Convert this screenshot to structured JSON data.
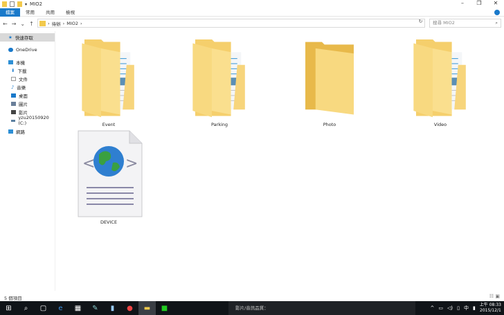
{
  "window": {
    "title": "MIO2",
    "minimize": "–",
    "restore": "❐",
    "close": "✕"
  },
  "ribbon": {
    "tabs": [
      "檔案",
      "常用",
      "共用",
      "檢視"
    ]
  },
  "nav": {
    "back": "←",
    "forward": "→",
    "recent": "⌄",
    "up": "↑",
    "path": [
      "待辦",
      "MIO2"
    ],
    "refresh": "↻",
    "search_placeholder": "搜尋 MIO2"
  },
  "sidebar": {
    "items": [
      {
        "label": "快速存取",
        "icon": "star-icon",
        "color": "#1979ca"
      },
      {
        "label": "OneDrive",
        "icon": "cloud-icon",
        "color": "#1979ca"
      },
      {
        "label": "本機",
        "icon": "computer-icon",
        "color": "#2d8fd5"
      },
      {
        "label": "下載",
        "icon": "download-icon",
        "color": "#1979ca"
      },
      {
        "label": "文件",
        "icon": "document-icon",
        "color": "#999999"
      },
      {
        "label": "音樂",
        "icon": "music-icon",
        "color": "#1979ca"
      },
      {
        "label": "桌面",
        "icon": "desktop-icon",
        "color": "#1979ca"
      },
      {
        "label": "圖片",
        "icon": "pictures-icon",
        "color": "#6a7f99"
      },
      {
        "label": "影片",
        "icon": "videos-icon",
        "color": "#444444"
      },
      {
        "label": "yzu20150920 (C:)",
        "icon": "drive-icon",
        "color": "#5a7fa0"
      },
      {
        "label": "網路",
        "icon": "network-icon",
        "color": "#2d8fd5"
      }
    ]
  },
  "files": [
    {
      "name": "Event",
      "type": "folder-with-files"
    },
    {
      "name": "Parking",
      "type": "folder-with-files"
    },
    {
      "name": "Photo",
      "type": "folder-empty"
    },
    {
      "name": "Video",
      "type": "folder-with-files"
    },
    {
      "name": "DEVICE",
      "type": "html-file"
    }
  ],
  "status": {
    "count": "5 個項目"
  },
  "toast": {
    "text": "影片/音訊品質："
  },
  "tray": {
    "ime": "中",
    "time": "上午 08:33",
    "date": "2015/12/1"
  }
}
